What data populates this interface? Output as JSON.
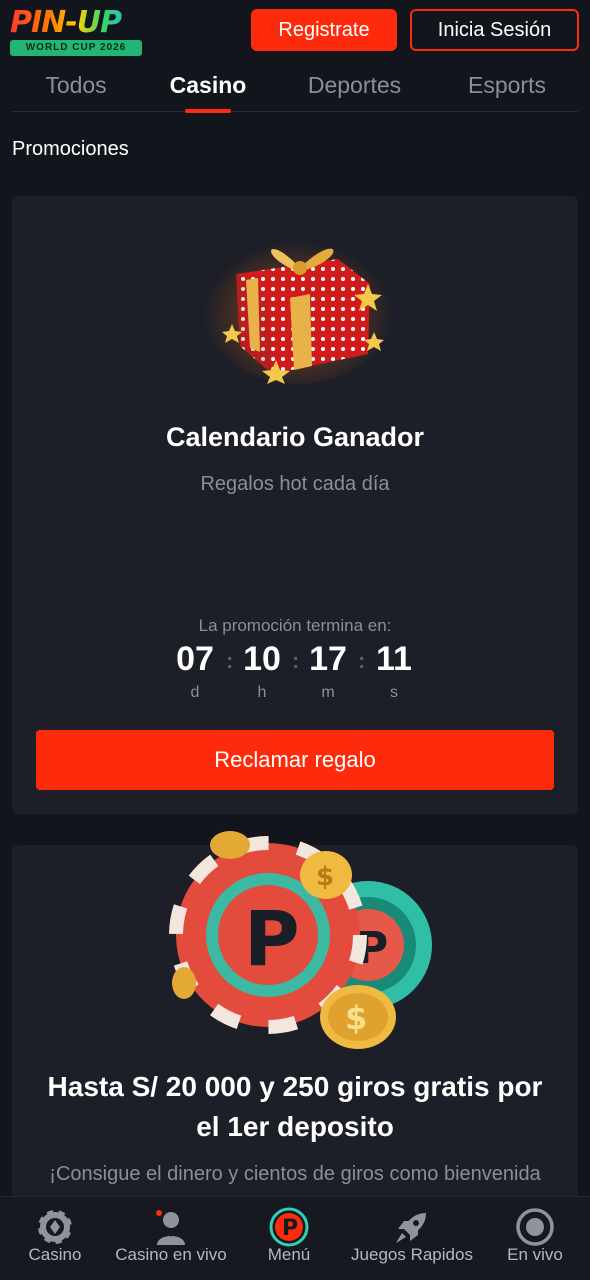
{
  "header": {
    "logo_text": "PIN-UP",
    "logo_badge": "WORLD CUP 2026",
    "register_label": "Registrate",
    "login_label": "Inicia Sesión"
  },
  "tabs": [
    {
      "label": "Todos",
      "active": false
    },
    {
      "label": "Casino",
      "active": true
    },
    {
      "label": "Deportes",
      "active": false
    },
    {
      "label": "Esports",
      "active": false
    }
  ],
  "section_title": "Promociones",
  "promo1": {
    "title": "Calendario Ganador",
    "subtitle": "Regalos hot cada día",
    "timer_label": "La promoción termina en:",
    "timer": [
      {
        "value": "07",
        "unit": "d"
      },
      {
        "value": "10",
        "unit": "h"
      },
      {
        "value": "17",
        "unit": "m"
      },
      {
        "value": "11",
        "unit": "s"
      }
    ],
    "button_label": "Reclamar regalo"
  },
  "promo2": {
    "title": "Hasta S/ 20 000 y 250 giros gratis por el 1er deposito",
    "subtitle": "¡Consigue el dinero y cientos de giros como bienvenida"
  },
  "bottom_nav": [
    {
      "label": "Casino",
      "icon": "casino-chip-icon"
    },
    {
      "label": "Casino en vivo",
      "icon": "live-dealer-icon"
    },
    {
      "label": "Menú",
      "icon": "pinup-logo-icon"
    },
    {
      "label": "Juegos Rapidos",
      "icon": "rocket-icon"
    },
    {
      "label": "En vivo",
      "icon": "live-target-icon"
    }
  ],
  "colors": {
    "accent": "#fd2b0b",
    "background": "#12151c",
    "card": "#1c1f27",
    "muted_text": "#8a8e96"
  }
}
